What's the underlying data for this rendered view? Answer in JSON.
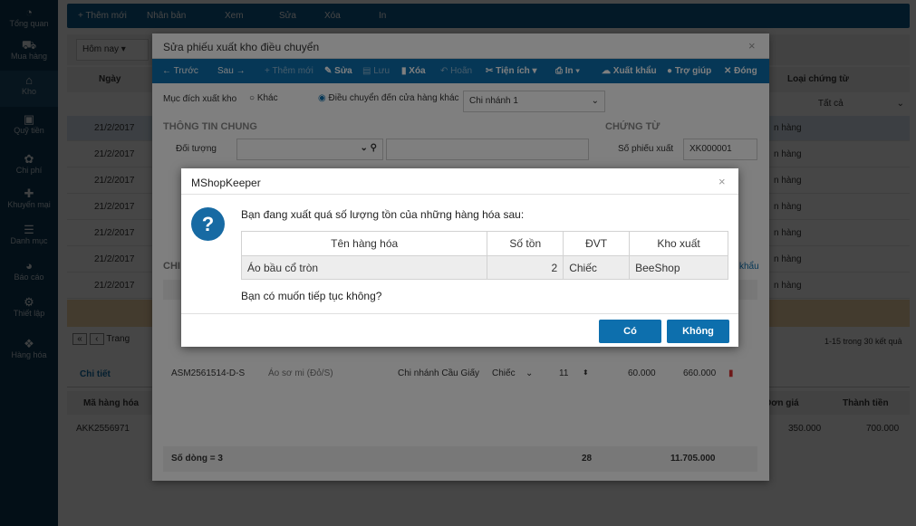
{
  "sidebar": {
    "items": [
      {
        "label": "Tổng quan",
        "icon": "dashboard-icon"
      },
      {
        "label": "Mua hàng",
        "icon": "cart-icon"
      },
      {
        "label": "Kho",
        "icon": "warehouse-icon"
      },
      {
        "label": "Quỹ tiền",
        "icon": "safe-icon"
      },
      {
        "label": "Chi phí",
        "icon": "money-icon"
      },
      {
        "label": "Khuyến mại",
        "icon": "gift-icon"
      },
      {
        "label": "Danh mục",
        "icon": "list-icon"
      },
      {
        "label": "Báo cáo",
        "icon": "pie-icon"
      },
      {
        "label": "Thiết lập",
        "icon": "gear-icon"
      },
      {
        "label": "Hàng hóa",
        "icon": "box-icon"
      }
    ]
  },
  "topbar": {
    "add": "+ Thêm mới",
    "copy": "Nhân bản",
    "view": "Xem",
    "edit": "Sửa",
    "delete": "Xóa",
    "print": "In"
  },
  "filter": {
    "period": "Hôm nay",
    "doc_type": "Tất cả"
  },
  "grid": {
    "col_date": "Ngày",
    "col_doctype": "Loại chứng từ",
    "rows": [
      {
        "date": "21/2/2017",
        "type": "n hàng"
      },
      {
        "date": "21/2/2017",
        "type": "n hàng"
      },
      {
        "date": "21/2/2017",
        "type": "n hàng"
      },
      {
        "date": "21/2/2017",
        "type": "n hàng"
      },
      {
        "date": "21/2/2017",
        "type": "n hàng"
      },
      {
        "date": "21/2/2017",
        "type": "n hàng"
      },
      {
        "date": "21/2/2017",
        "type": "n hàng"
      }
    ],
    "pager_label": "Trang",
    "results": "1-15 trong 30 kết quả"
  },
  "bottom": {
    "tab": "Chi tiết",
    "col_code": "Mã hàng hóa",
    "col_price": "Đơn giá",
    "col_total": "Thành tiền",
    "row": {
      "code": "AKK2556971",
      "price": "350.000",
      "total": "700.000"
    }
  },
  "modal": {
    "title": "Sửa phiếu xuất kho điều chuyển",
    "toolbar": {
      "prev": "← Trước",
      "next": "Sau →",
      "add": "+ Thêm mới",
      "edit": "Sửa",
      "save": "Lưu",
      "delete": "Xóa",
      "undo": "Hoãn",
      "util": "Tiện ích",
      "print": "In",
      "export": "Xuất khẩu",
      "help": "Trợ giúp",
      "close": "Đóng"
    },
    "purpose_label": "Mục đích xuất kho",
    "opt_other": "Khác",
    "opt_transfer": "Điều chuyển đến cửa hàng khác",
    "branch": "Chi nhánh 1",
    "section_general": "THÔNG TIN CHUNG",
    "section_doc": "CHỨNG TỪ",
    "subject_label": "Đối tượng",
    "doc_no_label": "Số phiếu xuất",
    "doc_no": "XK000001",
    "detail_section": "CHI",
    "detail_row": {
      "code": "ASM2561514-D-S",
      "name": "Áo sơ mi (Đỏ/S)",
      "branch": "Chi nhánh Cầu Giấy",
      "unit": "Chiếc",
      "qty": "11",
      "price": "60.000",
      "amount": "660.000"
    },
    "export_link": "khẩu",
    "footer": {
      "rows": "Số dòng = 3",
      "qty": "28",
      "amount": "11.705.000"
    }
  },
  "dialog": {
    "title": "MShopKeeper",
    "message": "Bạn đang xuất quá số lượng tồn của những hàng hóa sau:",
    "headers": [
      "Tên hàng hóa",
      "Số tồn",
      "ĐVT",
      "Kho xuất"
    ],
    "rows": [
      {
        "name": "Áo bầu cổ tròn",
        "stock": "2",
        "unit": "Chiếc",
        "warehouse": "BeeShop"
      }
    ],
    "question": "Bạn có muốn tiếp tục không?",
    "yes": "Có",
    "no": "Không"
  },
  "colors": {
    "sidebar": "#0e3a57",
    "toolbar": "#0d6fad",
    "primary_button": "#0d6fad",
    "icon_blue": "#176aa3"
  }
}
